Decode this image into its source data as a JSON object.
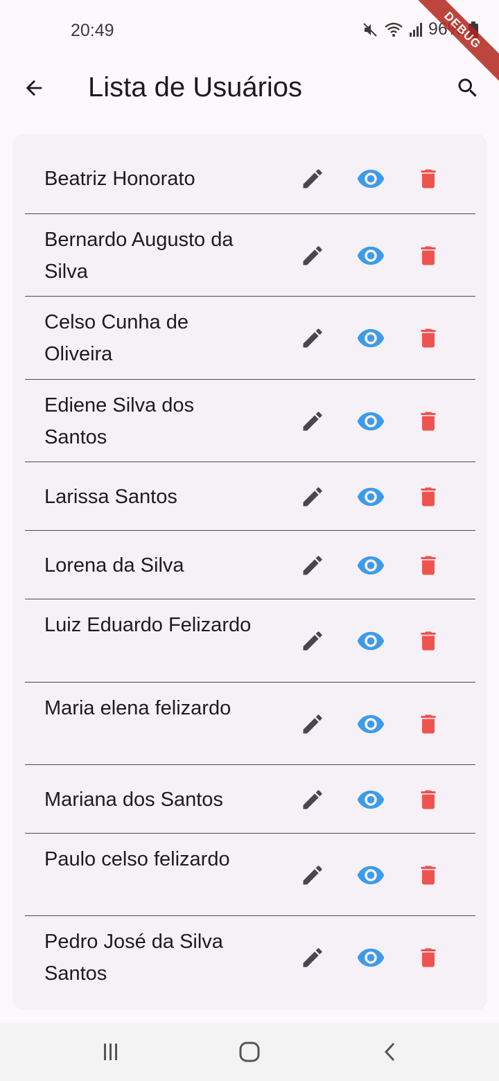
{
  "status_bar": {
    "time": "20:49",
    "battery": "96%",
    "icons": [
      "mute-icon",
      "wifi-icon",
      "signal-icon",
      "battery-icon"
    ]
  },
  "debug_banner": "DEBUG",
  "app_bar": {
    "title": "Lista de Usuários",
    "back_icon": "arrow-back-icon",
    "search_icon": "search-icon"
  },
  "colors": {
    "edit": "#4a454f",
    "view": "#3d9be9",
    "delete": "#ef5350",
    "card": "#f6f1f6"
  },
  "users": [
    {
      "name": "Beatriz Honorato"
    },
    {
      "name": "Bernardo Augusto da Silva"
    },
    {
      "name": "Celso Cunha de Oliveira"
    },
    {
      "name": "Ediene Silva dos Santos"
    },
    {
      "name": "Larissa Santos"
    },
    {
      "name": "Lorena da Silva"
    },
    {
      "name": "Luiz Eduardo Felizardo"
    },
    {
      "name": "Maria elena felizardo"
    },
    {
      "name": "Mariana dos Santos"
    },
    {
      "name": "Paulo celso felizardo"
    },
    {
      "name": "Pedro José da Silva Santos"
    }
  ],
  "nav_bar": {
    "icons": [
      "recent-apps-icon",
      "home-icon",
      "back-icon"
    ]
  }
}
